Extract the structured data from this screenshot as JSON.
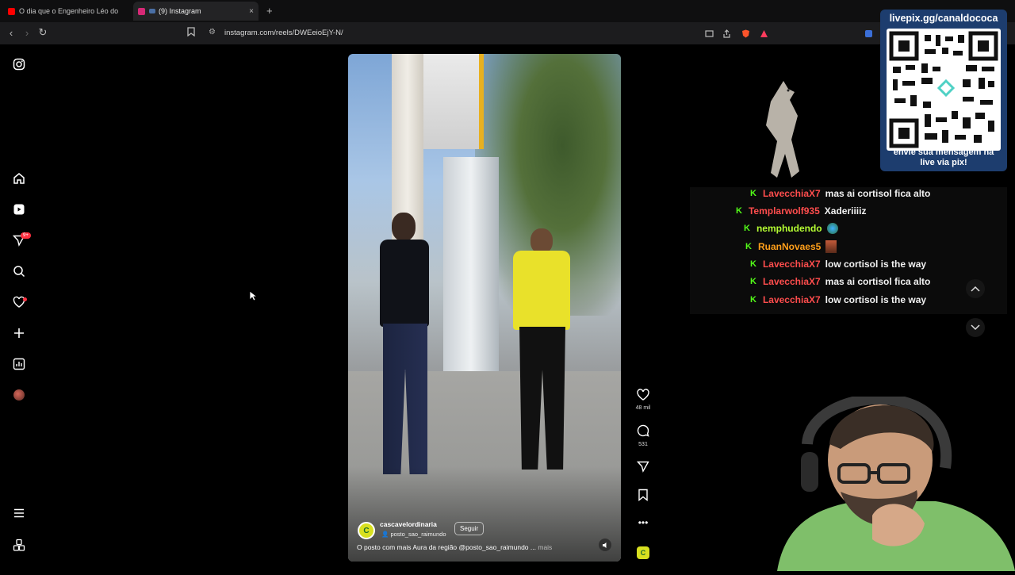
{
  "browser": {
    "tabs": [
      {
        "label": "O dia que o Engenheiro Léo do MBL",
        "color": "#ff0000"
      },
      {
        "label": "(9) Instagram",
        "color": "#d62976"
      }
    ],
    "new_tab_label": "+",
    "close_label": "×",
    "url": "instagram.com/reels/DWEeioEjY-N/"
  },
  "sidebar": {
    "notifications_badge": "9+",
    "icons": [
      "instagram-logo-icon",
      "home-icon",
      "reels-icon",
      "messages-icon",
      "search-icon",
      "notifications-icon",
      "create-icon",
      "dashboard-icon",
      "profile-avatar",
      "menu-icon",
      "more-icon"
    ]
  },
  "reel": {
    "author": "cascavelordinaria",
    "location": "posto_sao_raimundo",
    "follow_label": "Seguir",
    "caption": "O posto com mais Aura da região @posto_sao_raimundo ...",
    "more_label": "mais",
    "author_initial": "C",
    "likes": "48 mil",
    "comments": "531"
  },
  "overlay": {
    "pix_title": "livepix.gg/canaldococa",
    "pix_message_line1": "envie sua mensagem na",
    "pix_message_line2": "live via pix!"
  },
  "chat": {
    "badge": "K",
    "messages": [
      {
        "user": "LavecchiaX7",
        "text": "mas ai cortisol fica alto",
        "color": "#ff4d4d"
      },
      {
        "user": "Templarwolf935",
        "text": "Xaderiiiiz",
        "color": "#ff4d4d"
      },
      {
        "user": "nemphudendo",
        "text": "",
        "color": "#b6ff33"
      },
      {
        "user": "RuanNovaes5",
        "text": "",
        "color": "#ff9f1a"
      },
      {
        "user": "LavecchiaX7",
        "text": "low cortisol is the way",
        "color": "#ff4d4d"
      },
      {
        "user": "LavecchiaX7",
        "text": "mas ai cortisol fica alto",
        "color": "#ff4d4d"
      },
      {
        "user": "LavecchiaX7",
        "text": "low cortisol is the way",
        "color": "#ff4d4d"
      }
    ]
  }
}
